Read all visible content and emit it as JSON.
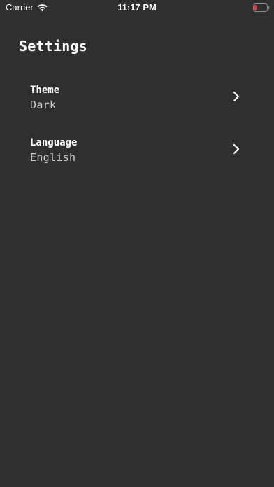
{
  "status_bar": {
    "carrier": "Carrier",
    "time": "11:17 PM",
    "wifi_icon": "wifi-icon",
    "battery_icon": "battery-low-icon",
    "battery_color": "#e53935"
  },
  "page": {
    "title": "Settings"
  },
  "settings": {
    "items": [
      {
        "label": "Theme",
        "value": "Dark",
        "icon": "chevron-right-icon"
      },
      {
        "label": "Language",
        "value": "English",
        "icon": "chevron-right-icon"
      }
    ]
  },
  "colors": {
    "background": "#2f2f2f",
    "text": "#ffffff",
    "secondary_text": "#d0d0d0"
  }
}
